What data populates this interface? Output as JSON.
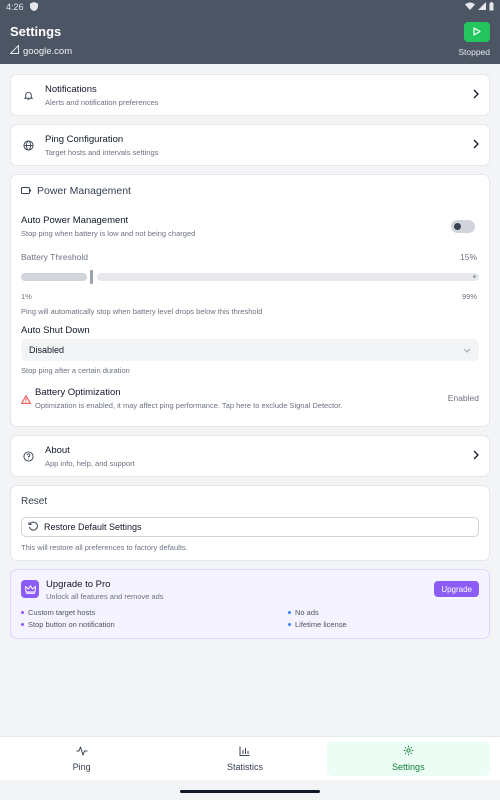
{
  "status_bar": {
    "time": "4:26"
  },
  "header": {
    "title": "Settings",
    "host": "google.com",
    "status": "Stopped",
    "play_color": "#22c55e"
  },
  "notifications": {
    "title": "Notifications",
    "subtitle": "Alerts and notification preferences"
  },
  "ping_config": {
    "title": "Ping Configuration",
    "subtitle": "Target hosts and intervals settings"
  },
  "power": {
    "title": "Power Management",
    "auto_power_label": "Auto Power Management",
    "auto_power_desc": "Stop ping when battery is low and not being charged",
    "auto_power_on": false,
    "threshold_label": "Battery Threshold",
    "threshold_value": "15%",
    "threshold_fraction": 0.15,
    "min_label": "1%",
    "max_label": "99%",
    "threshold_desc": "Ping will automatically stop when battery level drops below this threshold",
    "shutdown_label": "Auto Shut Down",
    "shutdown_value": "Disabled",
    "shutdown_desc": "Stop ping after a certain duration",
    "battery_opt_label": "Battery Optimization",
    "battery_opt_desc": "Optimization is enabled, it may affect ping performance. Tap here to exclude Signal Detector.",
    "battery_opt_status": "Enabled",
    "warning_color": "#ef4444"
  },
  "about": {
    "title": "About",
    "subtitle": "App info, help, and support"
  },
  "reset": {
    "title": "Reset",
    "button_label": "Restore Default Settings",
    "desc": "This will restore all preferences to factory defaults."
  },
  "pro": {
    "title": "Upgrade to Pro",
    "subtitle": "Unlock all features and remove ads",
    "button_label": "Upgrade",
    "accent": "#8b5cf6",
    "features": [
      "Custom target hosts",
      "No ads",
      "Stop button on notification",
      "Lifetime license"
    ]
  },
  "bottom_nav": {
    "items": [
      {
        "label": "Ping",
        "icon": "activity-icon"
      },
      {
        "label": "Statistics",
        "icon": "bar-chart-icon"
      },
      {
        "label": "Settings",
        "icon": "gear-icon",
        "active": true
      }
    ]
  }
}
